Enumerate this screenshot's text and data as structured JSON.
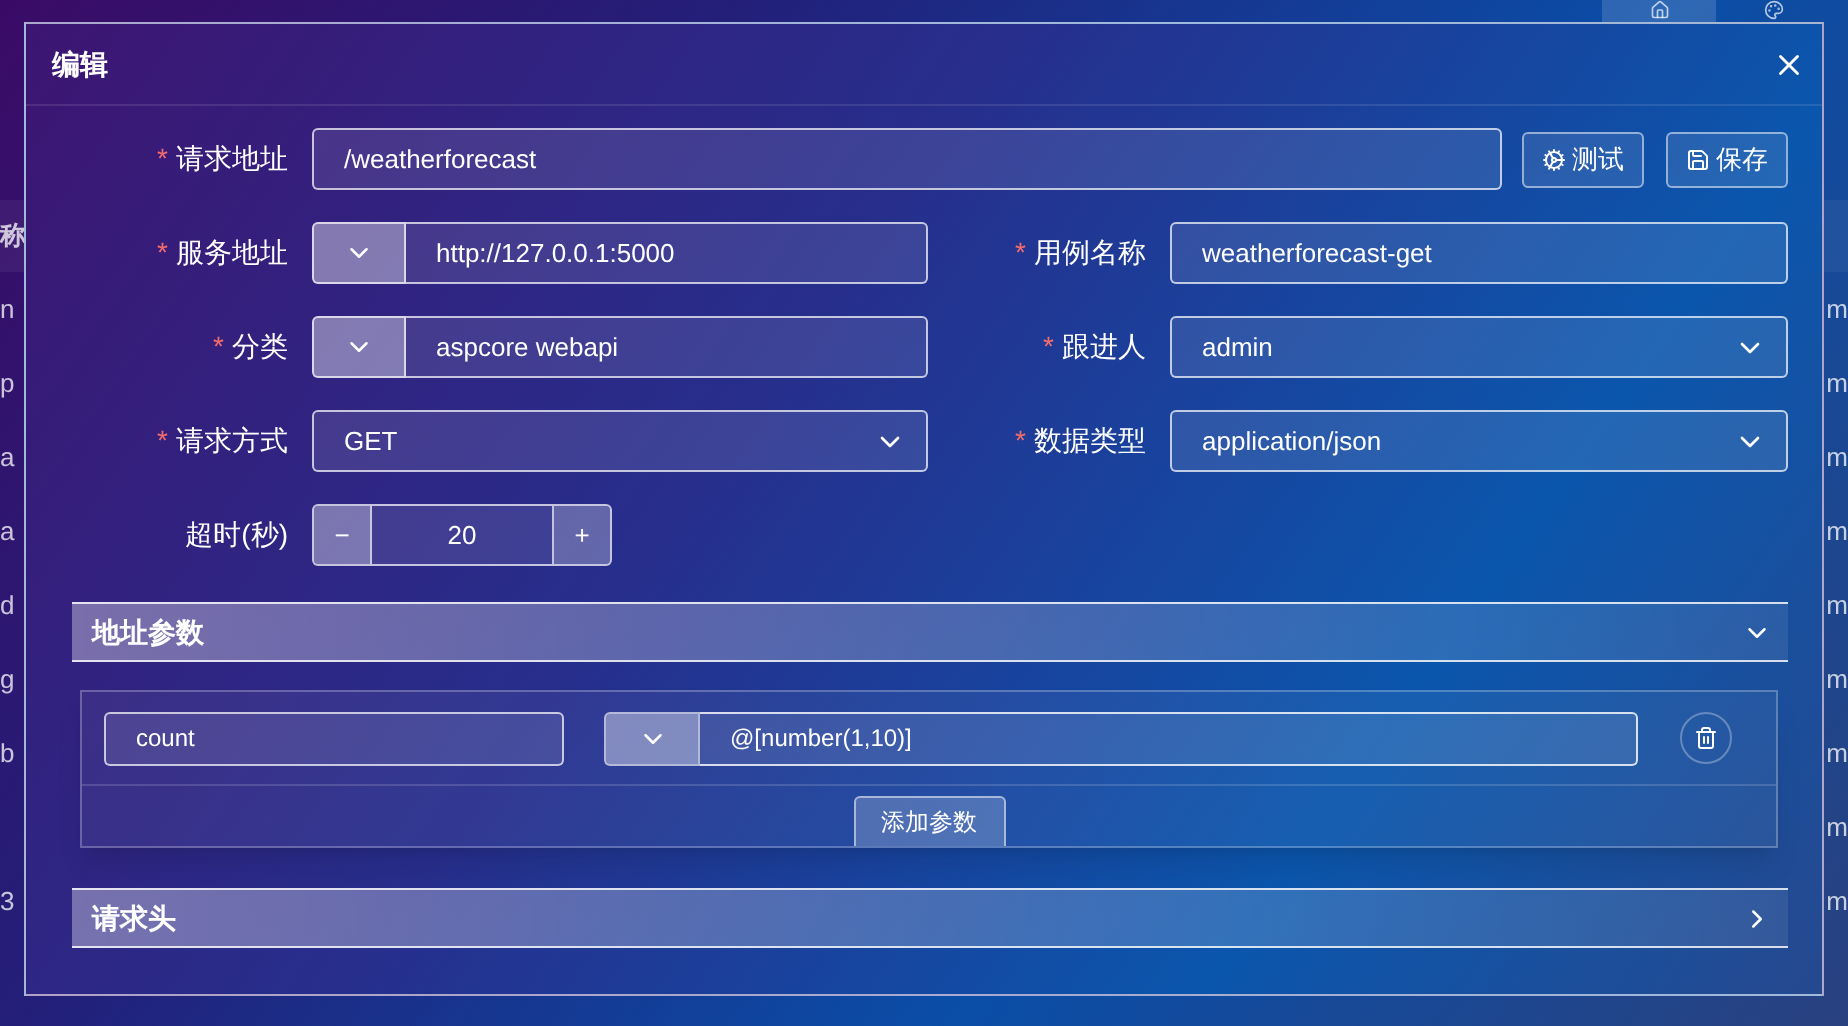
{
  "background_page": {
    "nav_tabs": [
      {
        "kind": "home",
        "selected": true
      },
      {
        "kind": "palette",
        "selected": false
      }
    ],
    "table": {
      "columns": [
        "称"
      ],
      "rows": [
        {
          "name": "n",
          "owner": "m"
        },
        {
          "name": "p",
          "owner": "m"
        },
        {
          "name": "a",
          "owner": "m"
        },
        {
          "name": "a",
          "owner": "m"
        },
        {
          "name": "d",
          "owner": "m"
        },
        {
          "name": "g",
          "owner": "m"
        },
        {
          "name": "b",
          "owner": "m"
        },
        {
          "owner": "m"
        },
        {
          "name": "3",
          "owner": "m"
        }
      ]
    }
  },
  "dialog": {
    "title": "编辑",
    "url_field": {
      "label": "请求地址",
      "required_mark": "*",
      "kind": "text",
      "value": "/weatherforecast"
    },
    "buttons": [
      {
        "label": "测试",
        "kind": "test"
      },
      {
        "label": "保存",
        "kind": "save"
      }
    ],
    "fields": [
      {
        "label": "服务地址",
        "required_mark": "*",
        "kind": "prefixed",
        "value": "http://127.0.0.1:5000"
      },
      {
        "label": "用例名称",
        "required_mark": "*",
        "kind": "text",
        "value": "weatherforecast-get"
      },
      {
        "label": "分类",
        "required_mark": "*",
        "kind": "prefixed",
        "value": "aspcore webapi"
      },
      {
        "label": "跟进人",
        "required_mark": "*",
        "kind": "select",
        "value": "admin"
      },
      {
        "label": "请求方式",
        "required_mark": "*",
        "kind": "select",
        "value": "GET"
      },
      {
        "label": "数据类型",
        "required_mark": "*",
        "kind": "select",
        "value": "application/json"
      },
      {
        "label": "超时(秒)",
        "kind": "stepper",
        "value": "20",
        "minus": "−",
        "plus": "+"
      }
    ],
    "sections": [
      {
        "title": "地址参数",
        "expanded": true,
        "params": [
          {
            "name": "count",
            "value": "@[number(1,10)]"
          }
        ],
        "add_button": "添加参数"
      },
      {
        "title": "请求头",
        "expanded": false
      }
    ]
  }
}
